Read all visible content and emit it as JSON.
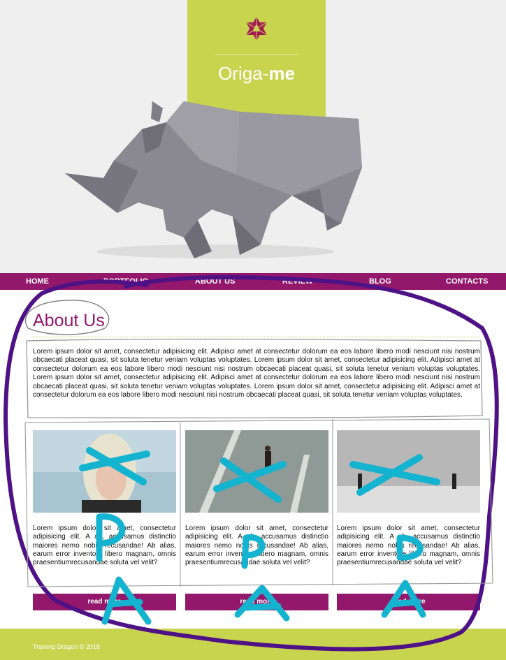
{
  "brand": {
    "name_light": "Origa-",
    "name_bold": "me"
  },
  "nav": {
    "items": [
      {
        "label": "HOME"
      },
      {
        "label": "PORTFOLIO"
      },
      {
        "label": "ABOUT US"
      },
      {
        "label": "REVIEW"
      },
      {
        "label": "BLOG"
      },
      {
        "label": "CONTACTS"
      }
    ]
  },
  "about": {
    "title": "About Us",
    "text": "Lorem ipsum dolor sit amet, consectetur adipisicing elit. Adipisci amet at consectetur dolorum ea eos labore libero modi nesciunt nisi nostrum obcaecati placeat quasi, sit soluta tenetur veniam voluptas voluptates. Lorem ipsum dolor sit amet, consectetur adipisicing elit. Adipisci amet at consectetur dolorum ea eos labore libero modi nesciunt nisi nostrum obcaecati placeat quasi, sit soluta tenetur veniam voluptas voluptates. Lorem ipsum dolor sit amet, consectetur adipisicing elit. Adipisci amet at consectetur dolorum ea eos labore libero modi nesciunt nisi nostrum obcaecati placeat quasi, sit soluta tenetur veniam voluptas voluptates. Lorem ipsum dolor sit amet, consectetur adipisicing elit. Adipisci amet at consectetur dolorum ea eos labore libero modi nesciunt nisi nostrum obcaecati placeat quasi, sit soluta tenetur veniam voluptas voluptates."
  },
  "cards": [
    {
      "text": "Lorem ipsum dolor sit amet, consectetur adipisicing elit. A ab, accusamus distinctio maiores nemo nobis recusandae! Ab alias, earum error inventore libero magnam, omnis praesentiumrecusandae soluta vel velit?",
      "button": "read more"
    },
    {
      "text": "Lorem ipsum dolor sit amet, consectetur adipisicing elit. A ab, accusamus distinctio maiores nemo nobis recusandae! Ab alias, earum error inventore libero magnam, omnis praesentiumrecusandae soluta vel velit?",
      "button": "read more"
    },
    {
      "text": "Lorem ipsum dolor sit amet, consectetur adipisicing elit. A ab, accusamus distinctio maiores nemo nobis recusandae! Ab alias, earum error inventore libero magnam, omnis praesentiumrecusandae soluta vel velit?",
      "button": "read more"
    }
  ],
  "footer": {
    "text": "Training Dragon © 2018"
  },
  "annotations": {
    "marks": [
      "P",
      "A",
      "P",
      "A",
      "D",
      "A"
    ]
  },
  "colors": {
    "accent": "#93176b",
    "lime": "#c8d34e",
    "hero_bg": "#efefef",
    "marker_blue": "#14b3d0",
    "marker_purple": "#4f1286"
  }
}
